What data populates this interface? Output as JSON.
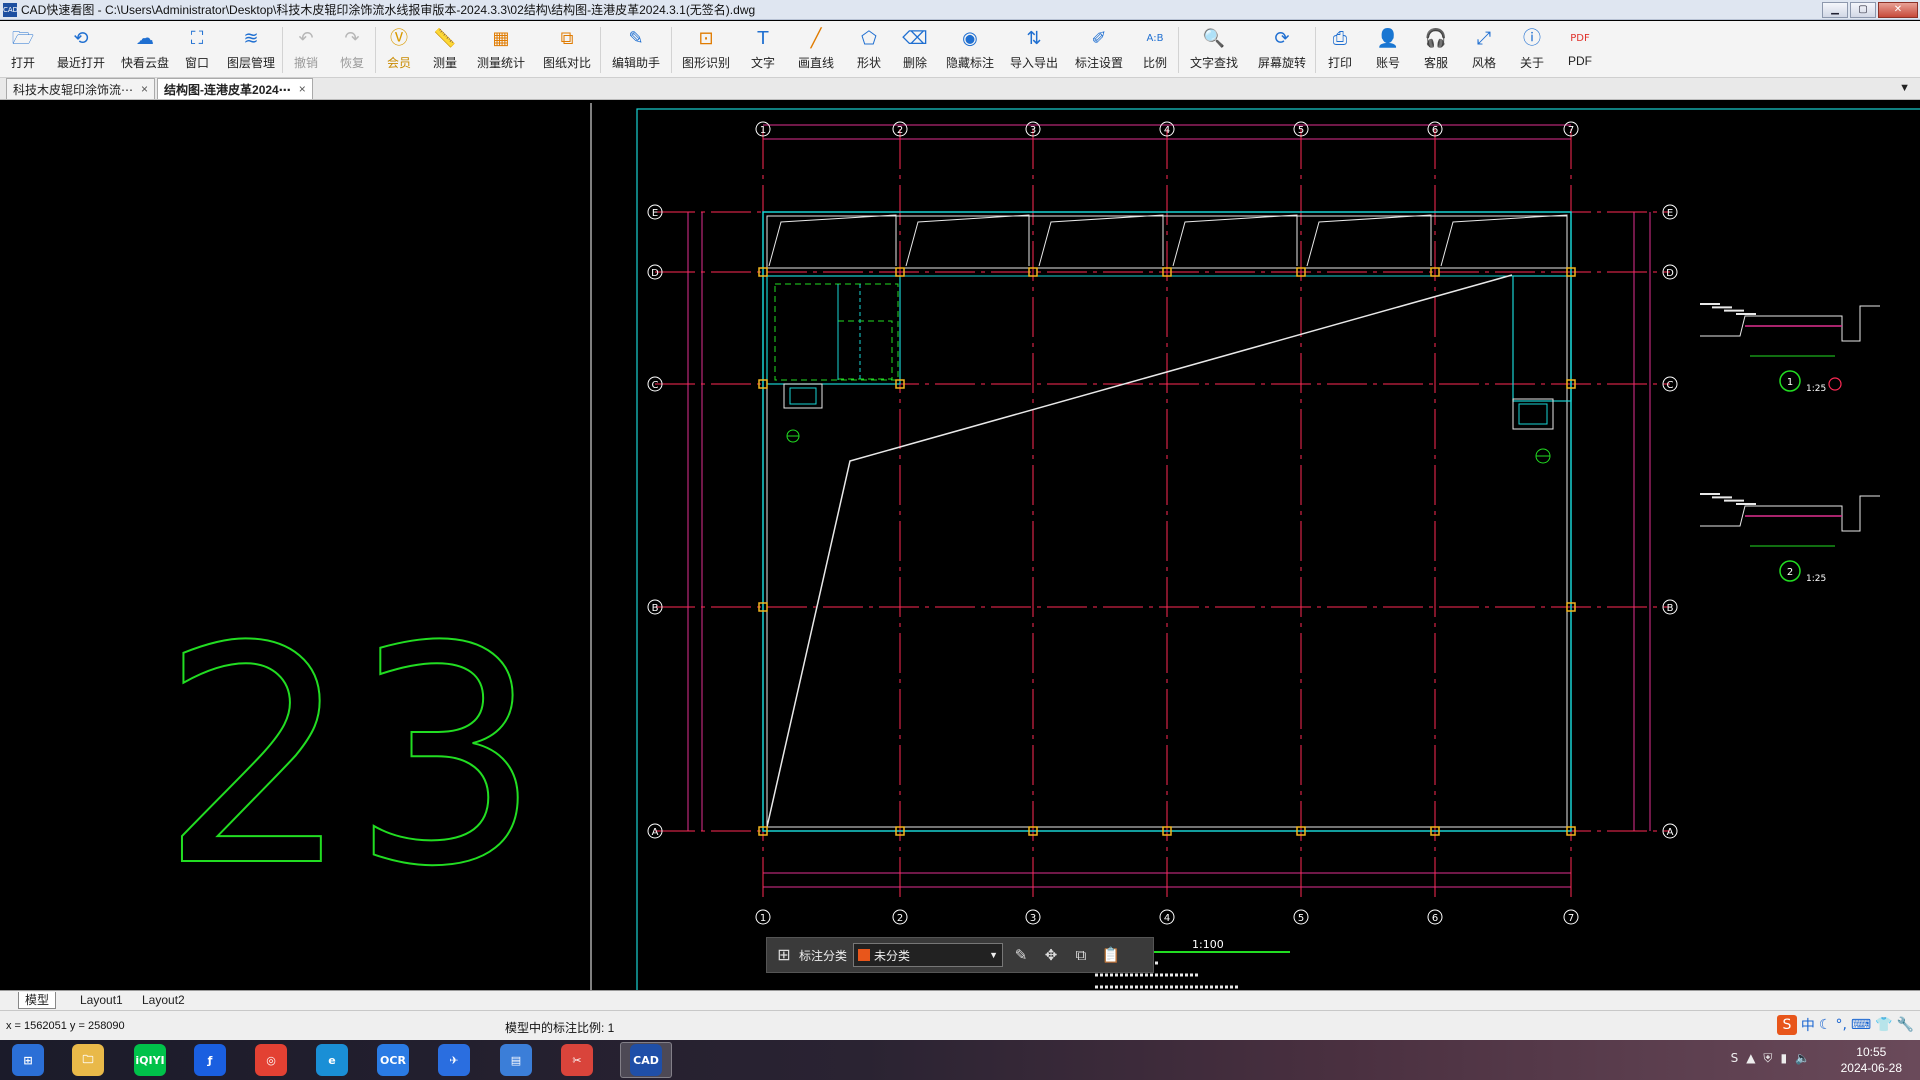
{
  "window": {
    "title": "CAD快速看图 - C:\\Users\\Administrator\\Desktop\\科技木皮辊印涂饰流水线报审版本-2024.3.3\\02结构\\结构图-连港皮革2024.3.1(无签名).dwg",
    "app_badge": "CAD"
  },
  "toolbar": [
    {
      "label": "打开",
      "icon": "folder-icon",
      "glyph": "🗁",
      "color": "#1f6fd1"
    },
    {
      "label": "最近打开",
      "icon": "history-icon",
      "glyph": "⟲",
      "color": "#1f6fd1"
    },
    {
      "label": "快看云盘",
      "icon": "cloud-icon",
      "glyph": "☁",
      "color": "#1f6fd1"
    },
    {
      "label": "窗口",
      "icon": "window-icon",
      "glyph": "⛶",
      "color": "#1f6fd1"
    },
    {
      "label": "图层管理",
      "icon": "layers-icon",
      "glyph": "≋",
      "color": "#1f6fd1"
    },
    {
      "label": "撤销",
      "icon": "undo-icon",
      "glyph": "↶",
      "color": "#b7b7b7",
      "disabled": true
    },
    {
      "label": "恢复",
      "icon": "redo-icon",
      "glyph": "↷",
      "color": "#b7b7b7",
      "disabled": true
    },
    {
      "label": "会员",
      "icon": "vip-icon",
      "glyph": "Ⓥ",
      "color": "#d99a00",
      "vip": true
    },
    {
      "label": "测量",
      "icon": "ruler-icon",
      "glyph": "📏",
      "color": "#1f6fd1"
    },
    {
      "label": "测量统计",
      "icon": "measure-stats-icon",
      "glyph": "▦",
      "color": "#e07b00"
    },
    {
      "label": "图纸对比",
      "icon": "compare-icon",
      "glyph": "⧉",
      "color": "#e07b00"
    },
    {
      "label": "编辑助手",
      "icon": "edit-assistant-icon",
      "glyph": "✎",
      "color": "#1f6fd1"
    },
    {
      "label": "图形识别",
      "icon": "shape-recognize-icon",
      "glyph": "⊡",
      "color": "#e07b00"
    },
    {
      "label": "文字",
      "icon": "text-icon",
      "glyph": "T",
      "color": "#1f6fd1"
    },
    {
      "label": "画直线",
      "icon": "line-icon",
      "glyph": "╱",
      "color": "#e07b00"
    },
    {
      "label": "形状",
      "icon": "shape-icon",
      "glyph": "⬠",
      "color": "#1f6fd1"
    },
    {
      "label": "删除",
      "icon": "eraser-icon",
      "glyph": "⌫",
      "color": "#1f6fd1"
    },
    {
      "label": "隐藏标注",
      "icon": "eye-hide-icon",
      "glyph": "◉",
      "color": "#1f6fd1"
    },
    {
      "label": "导入导出",
      "icon": "import-export-icon",
      "glyph": "⇅",
      "color": "#1f6fd1"
    },
    {
      "label": "标注设置",
      "icon": "annotation-settings-icon",
      "glyph": "✐",
      "color": "#1f6fd1"
    },
    {
      "label": "比例",
      "icon": "scale-icon",
      "glyph": "A:B",
      "color": "#1f6fd1"
    },
    {
      "label": "文字查找",
      "icon": "text-search-icon",
      "glyph": "🔍",
      "color": "#1f6fd1"
    },
    {
      "label": "屏幕旋转",
      "icon": "rotate-screen-icon",
      "glyph": "⟳",
      "color": "#1f6fd1"
    },
    {
      "label": "打印",
      "icon": "printer-icon",
      "glyph": "⎙",
      "color": "#1f6fd1"
    },
    {
      "label": "账号",
      "icon": "user-icon",
      "glyph": "👤",
      "color": "#1f6fd1"
    },
    {
      "label": "客服",
      "icon": "headset-icon",
      "glyph": "🎧",
      "color": "#1f6fd1"
    },
    {
      "label": "风格",
      "icon": "style-icon",
      "glyph": "⤢",
      "color": "#1f6fd1"
    },
    {
      "label": "关于",
      "icon": "info-icon",
      "glyph": "ⓘ",
      "color": "#1f6fd1"
    },
    {
      "label": "PDF",
      "icon": "pdf-icon",
      "glyph": "PDF",
      "color": "#e0302a"
    }
  ],
  "tabs": [
    {
      "label": "科技木皮辊印涂饰流⋯",
      "close": "×",
      "active": false
    },
    {
      "label": "结构图-连港皮革2024⋯",
      "close": "×",
      "active": true
    }
  ],
  "drawing": {
    "big_label": "23",
    "axes_cols": [
      "1",
      "2",
      "3",
      "4",
      "5",
      "6",
      "7"
    ],
    "axes_rows": [
      "E",
      "D",
      "C",
      "B",
      "A"
    ],
    "detail1_num": "1",
    "detail1_scale": "1:25",
    "detail2_num": "2",
    "detail2_scale": "1:25",
    "plan_title_scale": "1:100"
  },
  "annotation_bar": {
    "label": "标注分类",
    "selected": "未分类"
  },
  "layout_tabs": [
    "模型",
    "Layout1",
    "Layout2"
  ],
  "status": {
    "coords": "x = 1562051  y = 258090",
    "scale_text": "模型中的标注比例: 1"
  },
  "ime": [
    "S",
    "中",
    "☾",
    "°,",
    "⌨",
    "👕",
    "🔧"
  ],
  "taskbar": {
    "apps": [
      {
        "name": "start-button",
        "label": "⊞",
        "bg": "#2b6fd6"
      },
      {
        "name": "explorer-app",
        "label": "🗀",
        "bg": "#e9b949"
      },
      {
        "name": "iqiyi-app",
        "label": "iQIYI",
        "bg": "#00c24a"
      },
      {
        "name": "feishu-app",
        "label": "ƒ",
        "bg": "#1a5fe0"
      },
      {
        "name": "chrome-app",
        "label": "◎",
        "bg": "#e34133"
      },
      {
        "name": "edge-app",
        "label": "e",
        "bg": "#1a8fd6"
      },
      {
        "name": "ocr-app",
        "label": "OCR",
        "bg": "#2a7be4"
      },
      {
        "name": "dingtalk-app",
        "label": "✈",
        "bg": "#2a6ee0"
      },
      {
        "name": "notepad-app",
        "label": "▤",
        "bg": "#3b7ed8"
      },
      {
        "name": "tool-app",
        "label": "✂",
        "bg": "#d9443b"
      },
      {
        "name": "cad-app",
        "label": "CAD",
        "bg": "#1f4fa8"
      }
    ],
    "time": "10:55",
    "date": "2024-06-28"
  }
}
